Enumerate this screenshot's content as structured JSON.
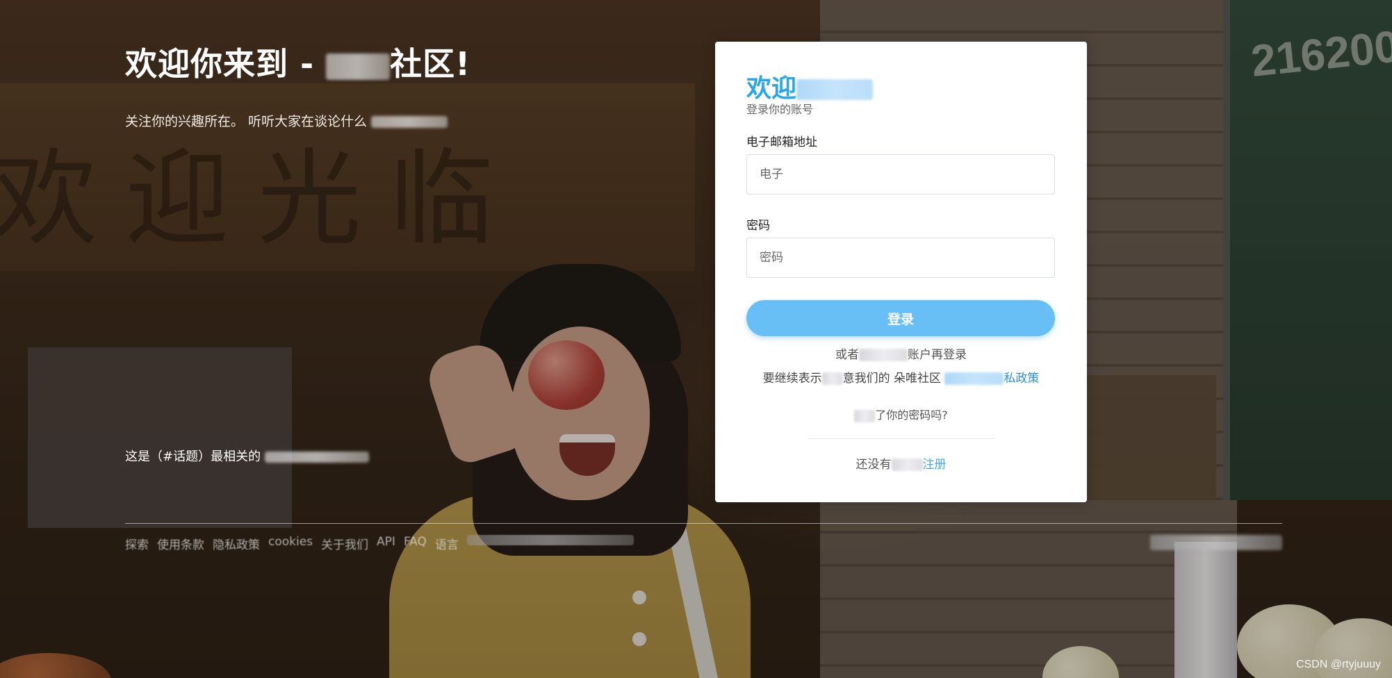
{
  "background": {
    "sign_text": "欢迎光临",
    "board_text": "216200"
  },
  "hero": {
    "title_prefix": "欢迎你来到 -",
    "title_suffix": "社区!",
    "subtitle_prefix": "关注你的兴趣所在。 听听大家在谈论什么",
    "topic_prefix": "这是（#话题）最相关的"
  },
  "footer": {
    "links": [
      "探索",
      "使用条款",
      "隐私政策",
      "cookies",
      "关于我们",
      "API",
      "FAQ",
      "语言"
    ]
  },
  "login": {
    "title": "欢迎",
    "subtitle": "登录你的账号",
    "email_label": "电子邮箱地址",
    "email_placeholder": "电子",
    "password_label": "密码",
    "password_placeholder": "密码",
    "login_button": "登录",
    "alt_login_prefix": "或者",
    "alt_login_suffix": "账户再登录",
    "terms_prefix": "要继续表示",
    "terms_middle": "意我们的 朵唯社区",
    "terms_link": "私政策",
    "forgot": "了你的密码吗?",
    "register_prefix": "还没有",
    "register_link": "注册"
  },
  "watermark": "CSDN @rtyjuuuy",
  "colors": {
    "accent": "#2aa7e8",
    "button": "#67bff6",
    "link": "#45a8ec"
  }
}
